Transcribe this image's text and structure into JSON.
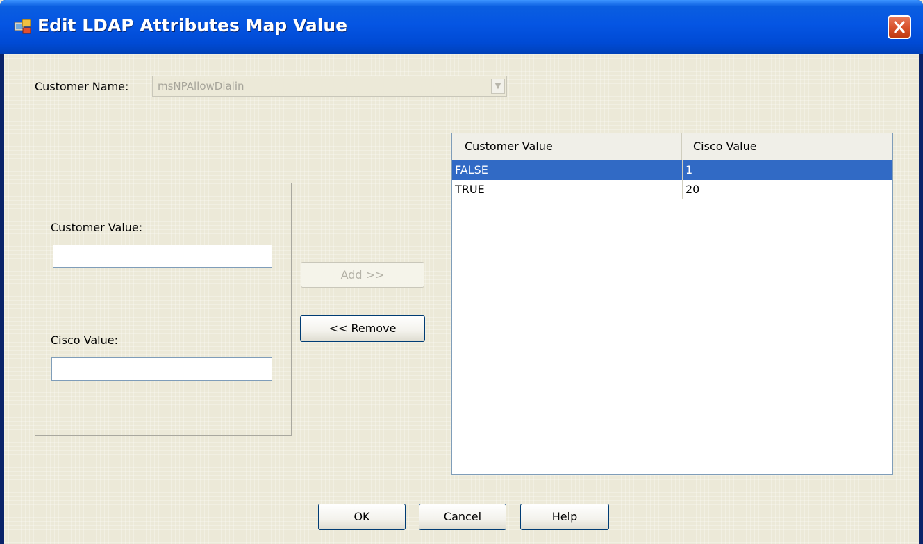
{
  "window": {
    "title": "Edit LDAP Attributes Map Value",
    "icon": "asdm-app-icon",
    "close_icon": "close-icon"
  },
  "form": {
    "customer_name_label": "Customer Name:",
    "customer_name_value": "msNPAllowDialin",
    "customer_value_label": "Customer Value:",
    "customer_value_input": "",
    "cisco_value_label": "Cisco Value:",
    "cisco_value_input": ""
  },
  "actions": {
    "add_label": "Add >>",
    "remove_label": "<< Remove"
  },
  "table": {
    "columns": [
      "Customer Value",
      "Cisco Value"
    ],
    "rows": [
      {
        "customer_value": "FALSE",
        "cisco_value": "1",
        "selected": true
      },
      {
        "customer_value": "TRUE",
        "cisco_value": "20",
        "selected": false
      }
    ]
  },
  "footer": {
    "ok_label": "OK",
    "cancel_label": "Cancel",
    "help_label": "Help"
  },
  "colors": {
    "titlebar": "#0555e3",
    "selection": "#316ac5",
    "dialog_bg": "#ece9d8"
  }
}
